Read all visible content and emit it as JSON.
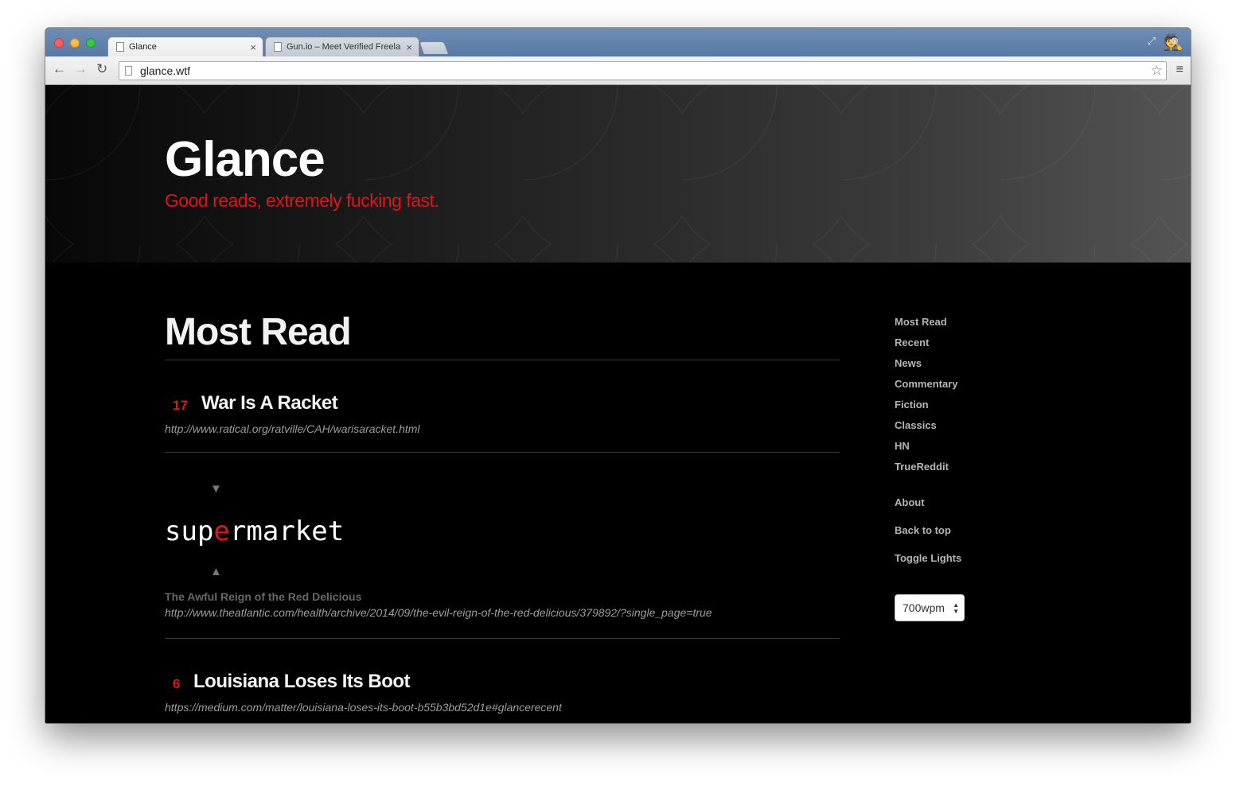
{
  "browser": {
    "tabs": [
      {
        "title": "Glance",
        "close": "×"
      },
      {
        "title": "Gun.io – Meet Verified Freelancers",
        "close": "×"
      }
    ],
    "url": "glance.wtf",
    "icons": {
      "back": "←",
      "forward": "→",
      "reload": "↻",
      "star": "☆",
      "menu": "≡",
      "fullscreen": "⤢",
      "incognito": "🕵"
    }
  },
  "hero": {
    "title": "Glance",
    "tagline": "Good reads, extremely fucking fast."
  },
  "main": {
    "section_title": "Most Read",
    "articles": [
      {
        "count": "17",
        "title": "War Is A Racket",
        "url": "http://www.ratical.org/ratville/CAH/warisaracket.html"
      },
      {
        "count": "6",
        "title": "Louisiana Loses Its Boot",
        "url": "https://medium.com/matter/louisiana-loses-its-boot-b55b3bd52d1e#glancerecent"
      }
    ],
    "reader": {
      "up_arrow": "▼",
      "word_before": "sup",
      "word_pivot": "e",
      "word_after": "rmarket",
      "down_arrow": "▲",
      "title": "The Awful Reign of the Red Delicious",
      "url": "http://www.theatlantic.com/health/archive/2014/09/the-evil-reign-of-the-red-delicious/379892/?single_page=true"
    }
  },
  "sidebar": {
    "nav": [
      "Most Read",
      "Recent",
      "News",
      "Commentary",
      "Fiction",
      "Classics",
      "HN",
      "TrueReddit"
    ],
    "about": "About",
    "back_to_top": "Back to top",
    "toggle_lights": "Toggle Lights",
    "wpm": {
      "selected": "700wpm"
    }
  },
  "colors": {
    "accent": "#e0151b",
    "background": "#000000",
    "link": "#b5b5b5"
  }
}
